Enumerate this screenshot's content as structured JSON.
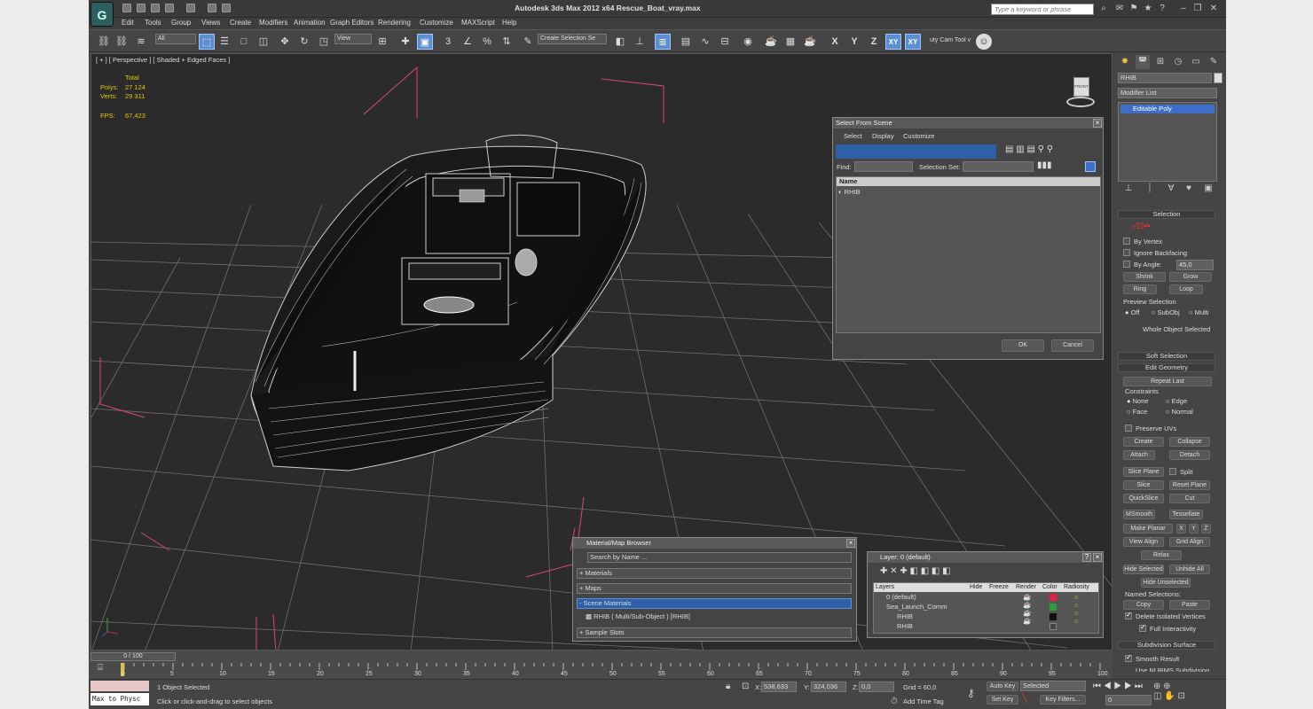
{
  "window": {
    "title": "Autodesk 3ds Max  2012 x64     Rescue_Boat_vray.max",
    "search_placeholder": "Type a keyword or phrase",
    "logo_text": "G"
  },
  "menu": [
    "Edit",
    "Tools",
    "Group",
    "Views",
    "Create",
    "Modifiers",
    "Animation",
    "Graph Editors",
    "Rendering",
    "Customize",
    "MAXScript",
    "Help"
  ],
  "toolbar": {
    "filter": "All",
    "refcoord": "View",
    "named_selection": "Create Selection Se",
    "axes": [
      "X",
      "Y",
      "Z",
      "XY",
      "XY"
    ],
    "cam_tool": "uty Cam Tool v"
  },
  "viewport": {
    "label": "[ + ] [ Perspective ] [ Shaded + Edged Faces ]",
    "stats": {
      "total_label": "Total",
      "polys_label": "Polys:",
      "polys": "27 124",
      "verts_label": "Verts:",
      "verts": "29 311",
      "fps_label": "FPS:",
      "fps": "67,423"
    },
    "viewcube": "FRONT"
  },
  "command_panel": {
    "object_name": "RHIB",
    "modifier_list": "Modifier List",
    "stack_item": "Editable Poly",
    "selection_title": "Selection",
    "by_vertex": "By Vertex",
    "ignore_backfacing": "Ignore Backfacing",
    "by_angle": "By Angle:",
    "angle_value": "45,0",
    "shrink": "Shrink",
    "grow": "Grow",
    "ring": "Ring",
    "loop": "Loop",
    "preview_selection": "Preview Selection",
    "off": "Off",
    "subobj": "SubObj",
    "multi": "Multi",
    "whole_object": "Whole Object Selected",
    "soft_selection": "Soft Selection",
    "edit_geometry": "Edit Geometry",
    "repeat_last": "Repeat Last",
    "constraints": "Constraints",
    "none": "None",
    "edge": "Edge",
    "face": "Face",
    "normal": "Normal",
    "preserve_uvs": "Preserve UVs",
    "create": "Create",
    "collapse": "Collapse",
    "attach": "Attach",
    "detach": "Detach",
    "slice_plane": "Slice Plane",
    "split": "Split",
    "slice": "Slice",
    "reset_plane": "Reset Plane",
    "quickslice": "QuickSlice",
    "cut": "Cut",
    "msmooth": "MSmooth",
    "tessellate": "Tessellate",
    "make_planar": "Make Planar",
    "x": "X",
    "y": "Y",
    "z": "Z",
    "view_align": "View Align",
    "grid_align": "Grid Align",
    "relax": "Relax",
    "hide_selected": "Hide Selected",
    "unhide_all": "Unhide All",
    "hide_unselected": "Hide Unselected",
    "named_selections": "Named Selections:",
    "copy": "Copy",
    "paste": "Paste",
    "delete_isolated": "Delete Isolated Vertices",
    "full_interactivity": "Full Interactivity",
    "subdivision_surface": "Subdivision Surface",
    "smooth_result": "Smooth Result",
    "use_nurms": "Use NURMS Subdivision"
  },
  "select_dialog": {
    "title": "Select From Scene",
    "menus": [
      "Select",
      "Display",
      "Customize"
    ],
    "find_label": "Find:",
    "selset_label": "Selection Set:",
    "col_name": "Name",
    "items": [
      "RHIB"
    ],
    "ok": "OK",
    "cancel": "Cancel"
  },
  "material_browser": {
    "title": "Material/Map Browser",
    "search": "Search by Name ...",
    "groups": [
      "+ Materials",
      "+ Maps",
      "- Scene Materials"
    ],
    "scene_item": "RHIB  ( Multi/Sub-Object )  [RHIB]",
    "sample_slots": "+ Sample Slots"
  },
  "layer_dialog": {
    "title": "Layer: 0 (default)",
    "help": "?",
    "headers": [
      "Layers",
      "Hide",
      "Freeze",
      "Render",
      "Color",
      "Radiosity"
    ],
    "rows": [
      {
        "name": "0 (default)",
        "color": "#e0204a"
      },
      {
        "name": "Sea_Launch_Comm",
        "color": "#27a23a"
      },
      {
        "name": "RHIB",
        "color": "#111111"
      },
      {
        "name": "RHIB",
        "color": "#444444"
      }
    ]
  },
  "timeline": {
    "frame_label": "0 / 100",
    "ticks": [
      "0",
      "5",
      "10",
      "15",
      "20",
      "25",
      "30",
      "35",
      "40",
      "45",
      "50",
      "55",
      "60",
      "65",
      "70",
      "75",
      "80",
      "85",
      "90",
      "95",
      "100"
    ]
  },
  "status": {
    "maxscript": "Max to Physc",
    "objects_selected": "1 Object Selected",
    "prompt": "Click or click-and-drag to select objects",
    "x_label": "X:",
    "x": "538,633",
    "y_label": "Y:",
    "y": "324,036",
    "z_label": "Z:",
    "z": "0,0",
    "grid": "Grid = 60,0",
    "add_time_tag": "Add Time Tag",
    "auto_key": "Auto Key",
    "set_key": "Set Key",
    "selected": "Selected",
    "key_filters": "Key Filters...",
    "frame": "0"
  }
}
